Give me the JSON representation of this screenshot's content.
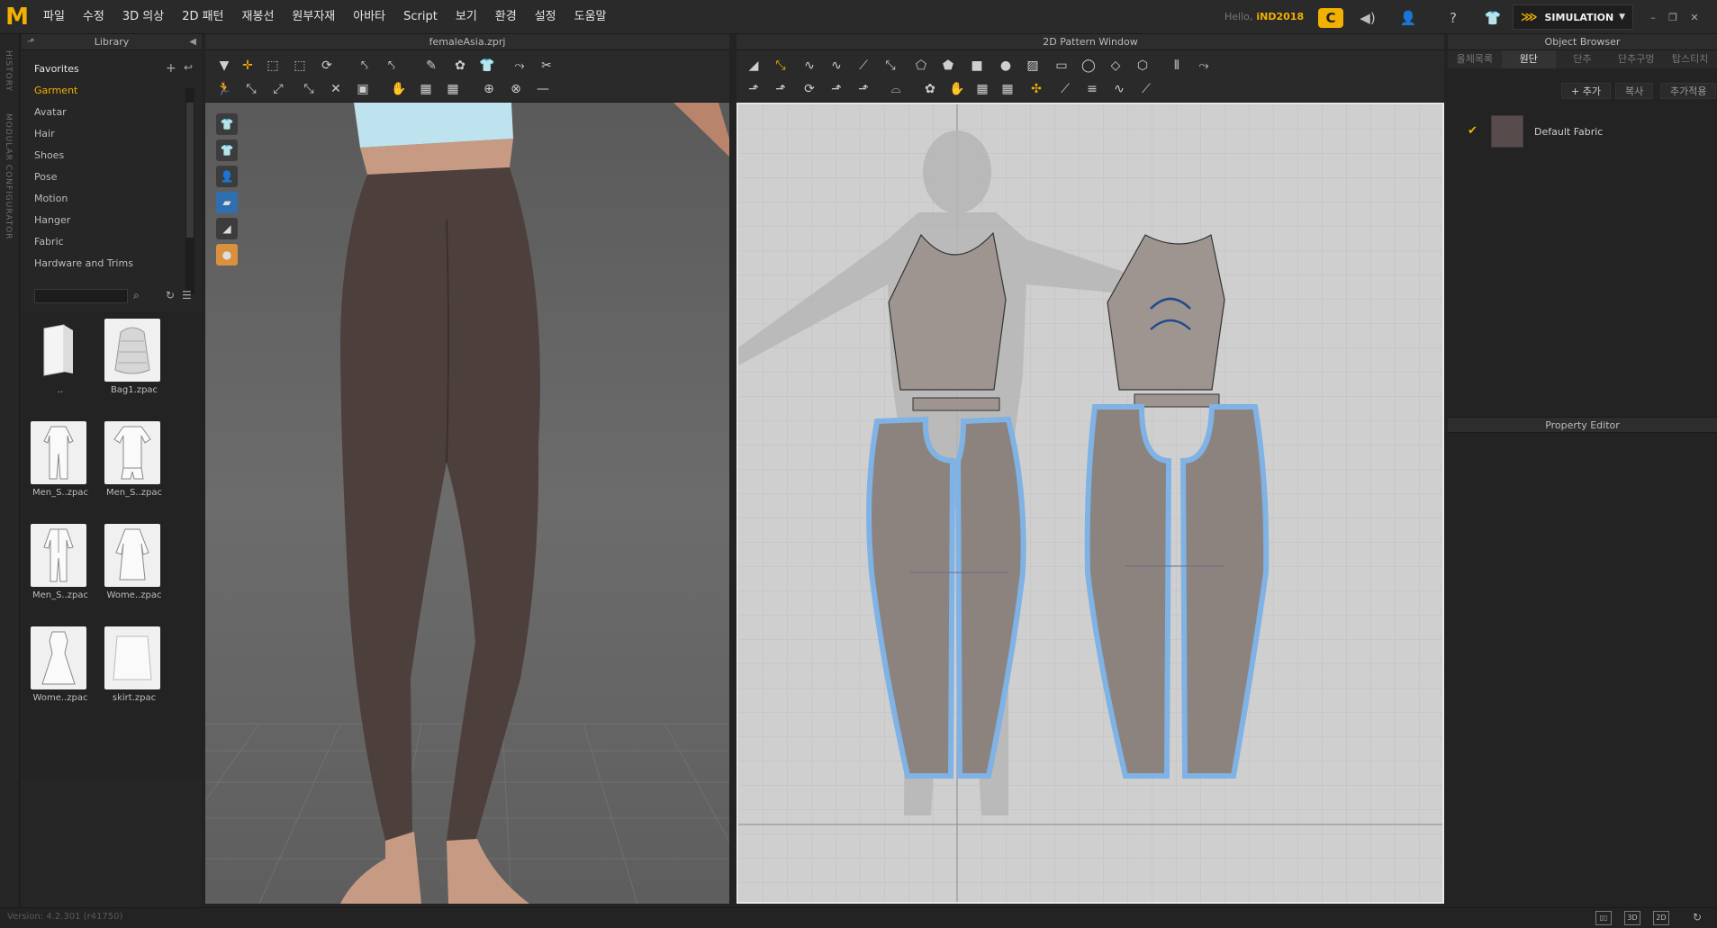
{
  "app": {
    "logo": "M",
    "menu": [
      "파일",
      "수정",
      "3D 의상",
      "2D 패턴",
      "재봉선",
      "원부자재",
      "아바타",
      "Script",
      "보기",
      "환경",
      "설정",
      "도움말"
    ],
    "hello_label": "Hello,",
    "user": "iND2018",
    "simulation_label": "SIMULATION",
    "version": "Version: 4.2.301 (r41750)"
  },
  "side_tabs": [
    "HISTORY",
    "MODULAR CONFIGURATOR"
  ],
  "library": {
    "title": "Library",
    "favorites_label": "Favorites",
    "items": [
      "Garment",
      "Avatar",
      "Hair",
      "Shoes",
      "Pose",
      "Motion",
      "Hanger",
      "Fabric",
      "Hardware and Trims"
    ],
    "active_item": "Garment",
    "files": [
      "..",
      "Bag1.zpac",
      "Men_S..zpac",
      "Men_S..zpac",
      "Men_S..zpac",
      "Wome..zpac",
      "Wome..zpac",
      "skirt.zpac"
    ]
  },
  "view3d": {
    "title": "femaleAsia.zprj"
  },
  "view2d": {
    "title": "2D Pattern Window"
  },
  "object_browser": {
    "title": "Object Browser",
    "tabs": [
      "올체목록",
      "원단",
      "단추",
      "단추구멍",
      "탑스티치"
    ],
    "active_tab": "원단",
    "actions": [
      "+ 추가",
      "복사",
      "추가적용"
    ],
    "fabric_name": "Default Fabric",
    "fabric_color": "#574b4b"
  },
  "property_editor": {
    "title": "Property Editor"
  },
  "colors": {
    "accent": "#f2b000",
    "pattern_outline": "#5b9bd5"
  }
}
